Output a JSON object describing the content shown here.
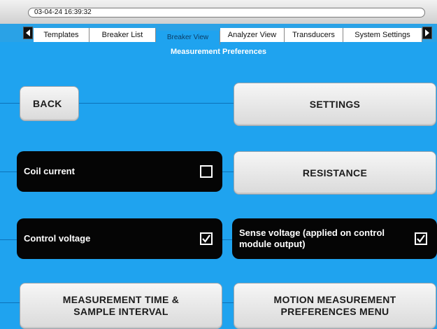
{
  "status": {
    "datetime": "03-04-24 16:39:32"
  },
  "tabs": [
    {
      "label": "Templates"
    },
    {
      "label": "Breaker List"
    },
    {
      "label": "Breaker View"
    },
    {
      "label": "Analyzer View"
    },
    {
      "label": "Transducers"
    },
    {
      "label": "System Settings"
    }
  ],
  "page": {
    "title": "Measurement Preferences"
  },
  "buttons": {
    "back": "BACK",
    "settings": "SETTINGS",
    "resistance": "RESISTANCE",
    "measurement_time": "MEASUREMENT TIME  & SAMPLE INTERVAL",
    "motion_menu": "MOTION MEASUREMENT PREFERENCES MENU"
  },
  "toggles": {
    "coil_current": {
      "label": "Coil current",
      "checked": false
    },
    "control_voltage": {
      "label": "Control voltage",
      "checked": true
    },
    "sense_voltage": {
      "label": "Sense voltage (applied on control module output)",
      "checked": true
    }
  },
  "colors": {
    "background": "#1fa3ef",
    "toggle_bg": "#050505",
    "button_bg": "#e6e6e6"
  }
}
